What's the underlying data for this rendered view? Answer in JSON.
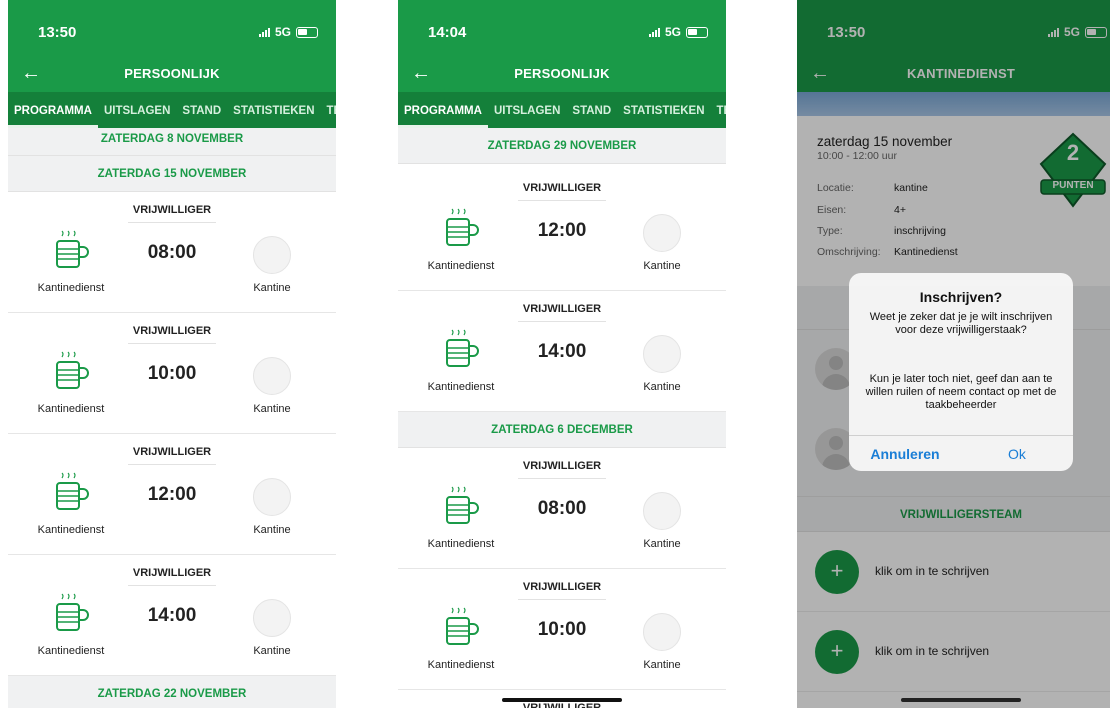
{
  "status": [
    {
      "time": "13:50",
      "network": "5G"
    },
    {
      "time": "14:04",
      "network": "5G"
    },
    {
      "time": "13:50",
      "network": "5G"
    }
  ],
  "nav": {
    "title_personal": "PERSOONLIJK",
    "title_kantine": "KANTINEDIENST"
  },
  "tabs": [
    "PROGRAMMA",
    "UITSLAGEN",
    "STAND",
    "STATISTIEKEN",
    "TE"
  ],
  "phone1": {
    "header_top": "ZATERDAG 8 NOVEMBER",
    "header_main": "ZATERDAG 15 NOVEMBER",
    "tasks": [
      {
        "type": "VRIJWILLIGER",
        "name": "Kantinedienst",
        "time": "08:00",
        "location": "Kantine"
      },
      {
        "type": "VRIJWILLIGER",
        "name": "Kantinedienst",
        "time": "10:00",
        "location": "Kantine"
      },
      {
        "type": "VRIJWILLIGER",
        "name": "Kantinedienst",
        "time": "12:00",
        "location": "Kantine"
      },
      {
        "type": "VRIJWILLIGER",
        "name": "Kantinedienst",
        "time": "14:00",
        "location": "Kantine"
      }
    ],
    "header_bottom": "ZATERDAG 22 NOVEMBER"
  },
  "phone2": {
    "header_top": "ZATERDAG 29 NOVEMBER",
    "tasks_a": [
      {
        "type": "VRIJWILLIGER",
        "name": "Kantinedienst",
        "time": "12:00",
        "location": "Kantine"
      },
      {
        "type": "VRIJWILLIGER",
        "name": "Kantinedienst",
        "time": "14:00",
        "location": "Kantine"
      }
    ],
    "header_mid": "ZATERDAG 6 DECEMBER",
    "tasks_b": [
      {
        "type": "VRIJWILLIGER",
        "name": "Kantinedienst",
        "time": "08:00",
        "location": "Kantine"
      },
      {
        "type": "VRIJWILLIGER",
        "name": "Kantinedienst",
        "time": "10:00",
        "location": "Kantine"
      }
    ],
    "partial_type": "VRIJWILLIGER"
  },
  "phone3": {
    "date": "zaterdag 15 november",
    "hours": "10:00 - 12:00 uur",
    "points_value": "2",
    "points_label": "PUNTEN",
    "details": [
      {
        "label": "Locatie:",
        "value": "kantine"
      },
      {
        "label": "Eisen:",
        "value": "4+"
      },
      {
        "label": "Type:",
        "value": "inschrijving"
      },
      {
        "label": "Omschrijving:",
        "value": "Kantinedienst"
      }
    ],
    "team_header": "VRIJWILLIGERSTEAM",
    "signup_text": "klik om in te schrijven",
    "dialog": {
      "title": "Inschrijven?",
      "message": "Weet je zeker dat je je wilt inschrijven voor deze vrijwilligerstaak?",
      "message2": "Kun je later toch niet, geef dan aan te willen ruilen of neem contact op met de taakbeheerder",
      "cancel": "Annuleren",
      "ok": "Ok"
    }
  },
  "colors": {
    "brand_green": "#1a9a48",
    "tab_green": "#14803a",
    "dialog_blue": "#1a7ed6"
  }
}
